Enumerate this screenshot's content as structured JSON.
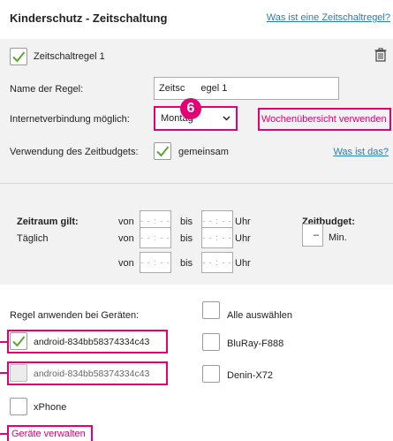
{
  "header": {
    "title": "Kinderschutz - Zeitschaltung",
    "help_link": "Was ist eine Zeitschaltregel?"
  },
  "rule": {
    "checkbox_label": "Zeitschaltregel 1",
    "checked": true,
    "name_label": "Name der Regel:",
    "name_value": "Zeitschaltregel 1",
    "name_visible_left": "Zeitsc",
    "name_visible_right": "egel 1",
    "internet_label": "Internetverbindung möglich:",
    "internet_select_value": "Montag",
    "week_overview_link": "Wochenübersicht verwenden",
    "budget_usage_label": "Verwendung des Zeitbudgets:",
    "budget_shared_label": "gemeinsam",
    "budget_shared_checked": true,
    "budget_help_link": "Was ist das?"
  },
  "badge": "6",
  "schedule": {
    "period_header": "Zeitraum gilt:",
    "budget_header": "Zeitbudget:",
    "row_label": "Täglich",
    "from_label": "von",
    "to_label": "bis",
    "unit_label": "Uhr",
    "time_placeholder": "- - : - -",
    "budget_value": "–",
    "budget_unit": "Min."
  },
  "devices": {
    "section_label": "Regel anwenden bei Geräten:",
    "select_all_label": "Alle auswählen",
    "items": [
      {
        "label": "android-834bb58374334c43",
        "checked": true
      },
      {
        "label": "android-834bb58374334c43",
        "checked": false
      },
      {
        "label": "xPhone",
        "checked": false
      },
      {
        "label": "BluRay-F888",
        "checked": false
      },
      {
        "label": "Denin-X72",
        "checked": false
      }
    ],
    "manage_link": "Geräte verwalten"
  },
  "colors": {
    "accent": "#e20074",
    "link": "#2b7bb9",
    "check": "#5aa832",
    "panel": "#f2f2f2"
  }
}
